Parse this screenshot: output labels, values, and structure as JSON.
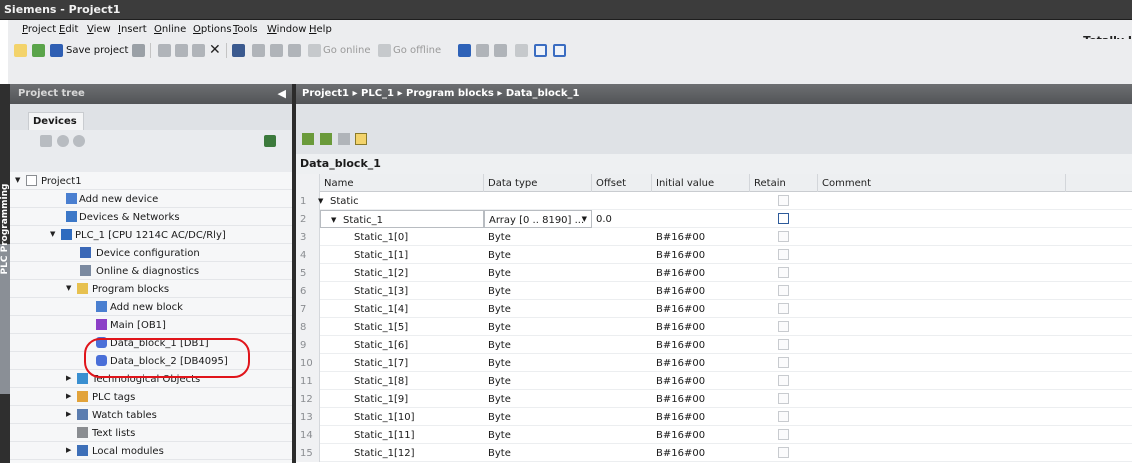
{
  "window": {
    "title": "Siemens  -  Project1",
    "right_label": "Totally I"
  },
  "menu": [
    "Project",
    "Edit",
    "View",
    "Insert",
    "Online",
    "Options",
    "Tools",
    "Window",
    "Help"
  ],
  "toolbar": {
    "save_label": "Save project",
    "go_online": "Go online",
    "go_offline": "Go offline"
  },
  "project_tree": {
    "title": "Project tree",
    "tab": "Devices",
    "side_label": "PLC Programming",
    "items": [
      {
        "label": "Project1",
        "icon": "project-icon",
        "expand": "open"
      },
      {
        "label": "Add new device",
        "icon": "add-device-icon",
        "expand": ""
      },
      {
        "label": "Devices & Networks",
        "icon": "network-icon",
        "expand": ""
      },
      {
        "label": "PLC_1 [CPU 1214C AC/DC/Rly]",
        "icon": "plc-icon",
        "expand": "open"
      },
      {
        "label": "Device configuration",
        "icon": "device-config-icon",
        "expand": ""
      },
      {
        "label": "Online & diagnostics",
        "icon": "diagnostics-icon",
        "expand": ""
      },
      {
        "label": "Program blocks",
        "icon": "folder-icon",
        "expand": "open"
      },
      {
        "label": "Add new block",
        "icon": "add-block-icon",
        "expand": ""
      },
      {
        "label": "Main [OB1]",
        "icon": "ob-icon",
        "expand": ""
      },
      {
        "label": "Data_block_1 [DB1]",
        "icon": "db-icon",
        "expand": ""
      },
      {
        "label": "Data_block_2 [DB4095]",
        "icon": "db-icon",
        "expand": ""
      },
      {
        "label": "Technological Objects",
        "icon": "tech-objects-icon",
        "expand": "closed"
      },
      {
        "label": "PLC tags",
        "icon": "tags-icon",
        "expand": "closed"
      },
      {
        "label": "Watch tables",
        "icon": "watch-icon",
        "expand": "closed"
      },
      {
        "label": "Text lists",
        "icon": "textlist-icon",
        "expand": ""
      },
      {
        "label": "Local modules",
        "icon": "modules-icon",
        "expand": "closed"
      }
    ]
  },
  "breadcrumb": [
    "Project1",
    "PLC_1",
    "Program blocks",
    "Data_block_1"
  ],
  "editor": {
    "title": "Data_block_1",
    "columns": [
      "Name",
      "Data type",
      "Offset",
      "Initial value",
      "Retain",
      "Comment"
    ],
    "rows": [
      {
        "num": "1",
        "name": "Static",
        "type": "",
        "offset": "",
        "initial": "",
        "level": 0,
        "expander": true
      },
      {
        "num": "2",
        "name": "Static_1",
        "type": "Array [0 .. 8190] ...",
        "offset": "0.0",
        "initial": "",
        "level": 1,
        "expander": true
      },
      {
        "num": "3",
        "name": "Static_1[0]",
        "type": "Byte",
        "offset": "",
        "initial": "B#16#00",
        "level": 2,
        "expander": false
      },
      {
        "num": "4",
        "name": "Static_1[1]",
        "type": "Byte",
        "offset": "",
        "initial": "B#16#00",
        "level": 2,
        "expander": false
      },
      {
        "num": "5",
        "name": "Static_1[2]",
        "type": "Byte",
        "offset": "",
        "initial": "B#16#00",
        "level": 2,
        "expander": false
      },
      {
        "num": "6",
        "name": "Static_1[3]",
        "type": "Byte",
        "offset": "",
        "initial": "B#16#00",
        "level": 2,
        "expander": false
      },
      {
        "num": "7",
        "name": "Static_1[4]",
        "type": "Byte",
        "offset": "",
        "initial": "B#16#00",
        "level": 2,
        "expander": false
      },
      {
        "num": "8",
        "name": "Static_1[5]",
        "type": "Byte",
        "offset": "",
        "initial": "B#16#00",
        "level": 2,
        "expander": false
      },
      {
        "num": "9",
        "name": "Static_1[6]",
        "type": "Byte",
        "offset": "",
        "initial": "B#16#00",
        "level": 2,
        "expander": false
      },
      {
        "num": "10",
        "name": "Static_1[7]",
        "type": "Byte",
        "offset": "",
        "initial": "B#16#00",
        "level": 2,
        "expander": false
      },
      {
        "num": "11",
        "name": "Static_1[8]",
        "type": "Byte",
        "offset": "",
        "initial": "B#16#00",
        "level": 2,
        "expander": false
      },
      {
        "num": "12",
        "name": "Static_1[9]",
        "type": "Byte",
        "offset": "",
        "initial": "B#16#00",
        "level": 2,
        "expander": false
      },
      {
        "num": "13",
        "name": "Static_1[10]",
        "type": "Byte",
        "offset": "",
        "initial": "B#16#00",
        "level": 2,
        "expander": false
      },
      {
        "num": "14",
        "name": "Static_1[11]",
        "type": "Byte",
        "offset": "",
        "initial": "B#16#00",
        "level": 2,
        "expander": false
      },
      {
        "num": "15",
        "name": "Static_1[12]",
        "type": "Byte",
        "offset": "",
        "initial": "B#16#00",
        "level": 2,
        "expander": false
      }
    ]
  },
  "colors": {
    "highlight": "#e0151b",
    "header_dark": "#525457",
    "db_icon": "#4a6fd8"
  }
}
